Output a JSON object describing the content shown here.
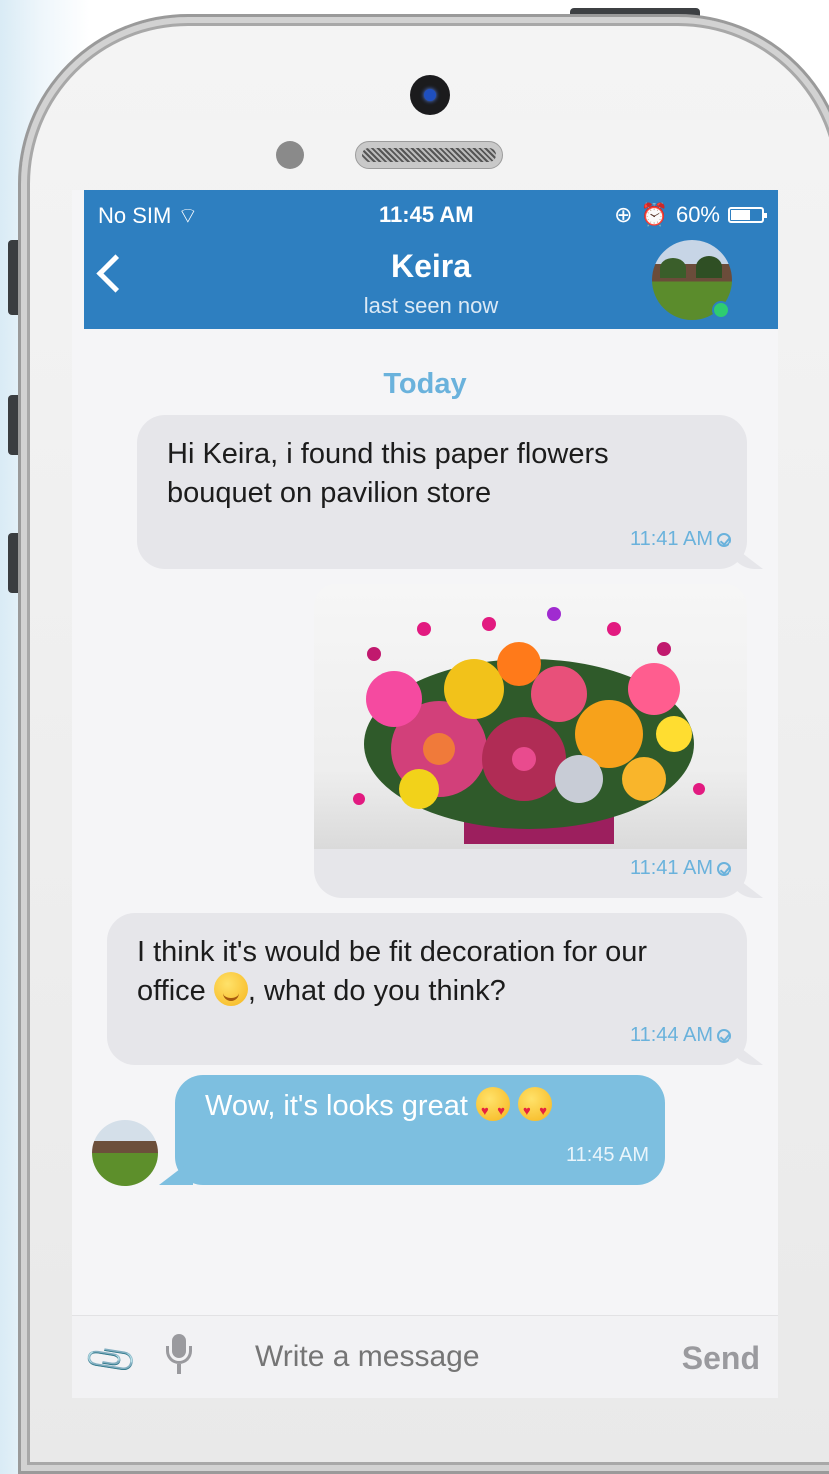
{
  "status_bar": {
    "carrier": "No SIM",
    "time": "11:45 AM",
    "battery": "60%"
  },
  "header": {
    "contact_name": "Keira",
    "subtitle": "last seen now"
  },
  "day_label": "Today",
  "messages": [
    {
      "text": "Hi Keira, i found this paper flowers bouquet on pavilion store",
      "time": "11:41 AM"
    },
    {
      "type": "image",
      "time": "11:41 AM"
    },
    {
      "text_before": "I think it's would be fit decoration for our office ",
      "text_after": ", what do you think?",
      "time": "11:44 AM"
    },
    {
      "text": "Wow, it's looks great ",
      "time": "11:45 AM"
    }
  ],
  "composer": {
    "placeholder": "Write a message",
    "send_label": "Send"
  },
  "colors": {
    "header_bg": "#2e7fc0",
    "incoming_bubble": "#7dbfe0",
    "outgoing_bubble": "#e6e6ea",
    "timestamp": "#6ab2dc"
  }
}
